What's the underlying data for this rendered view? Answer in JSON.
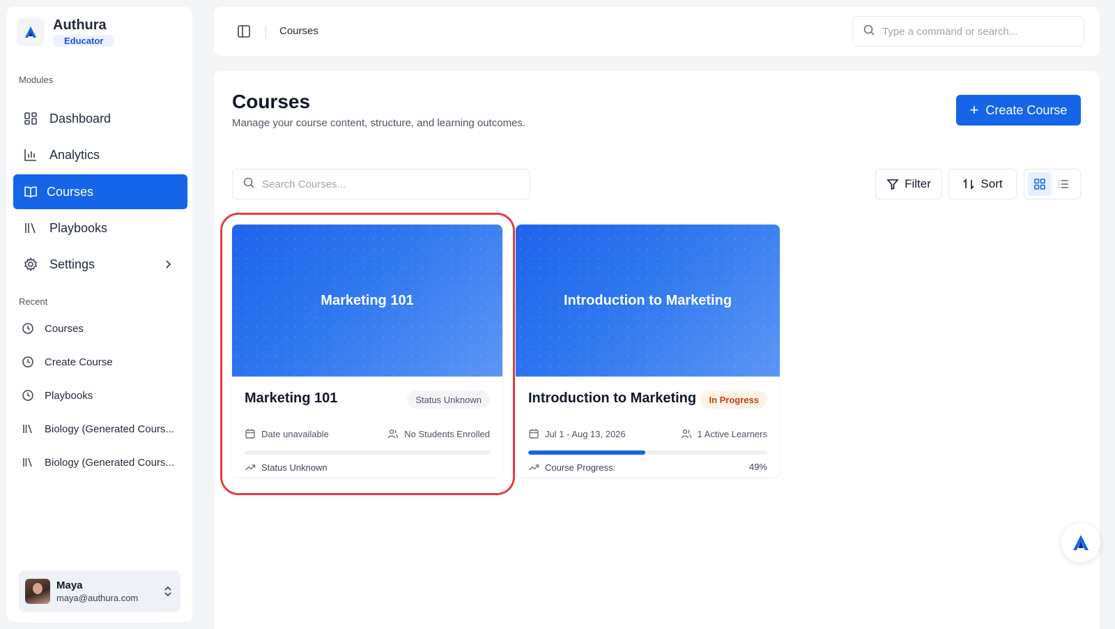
{
  "brand": {
    "name": "Authura",
    "role": "Educator"
  },
  "sidebar": {
    "modules_label": "Modules",
    "items": [
      {
        "label": "Dashboard",
        "icon": "dashboard-icon"
      },
      {
        "label": "Analytics",
        "icon": "bar-chart-icon"
      },
      {
        "label": "Courses",
        "icon": "book-open-icon",
        "active": true
      },
      {
        "label": "Playbooks",
        "icon": "library-icon"
      },
      {
        "label": "Settings",
        "icon": "gear-icon"
      }
    ],
    "recent_label": "Recent",
    "recent": [
      {
        "label": "Courses",
        "icon": "clock-icon"
      },
      {
        "label": "Create Course",
        "icon": "clock-icon"
      },
      {
        "label": "Playbooks",
        "icon": "clock-icon"
      },
      {
        "label": "Biology (Generated Cours...",
        "icon": "library-icon"
      },
      {
        "label": "Biology (Generated Cours...",
        "icon": "library-icon"
      }
    ]
  },
  "user": {
    "name": "Maya",
    "email": "maya@authura.com"
  },
  "topbar": {
    "breadcrumb": "Courses",
    "search_placeholder": "Type a command or search..."
  },
  "main": {
    "title": "Courses",
    "subtitle": "Manage your course content, structure, and learning outcomes.",
    "create_label": "Create Course",
    "search_placeholder": "Search Courses...",
    "filter_label": "Filter",
    "sort_label": "Sort",
    "view_mode": "grid"
  },
  "courses": [
    {
      "banner_title": "Marketing 101",
      "title": "Marketing 101",
      "status": "Status Unknown",
      "date": "Date unavailable",
      "students": "No Students Enrolled",
      "progress": 0,
      "footer": "Status Unknown",
      "footer_value": ""
    },
    {
      "banner_title": "Introduction to Marketing",
      "title": "Introduction to Marketing",
      "status": "In Progress",
      "date": "Jul 1 - Aug 13, 2026",
      "students": "1 Active Learners",
      "progress": 0.49,
      "footer": "Course Progress:",
      "footer_value": "49%"
    }
  ],
  "colors": {
    "accent": "#1565e8",
    "highlight": "#e53e3e",
    "badge_progress": "#c2410c"
  }
}
